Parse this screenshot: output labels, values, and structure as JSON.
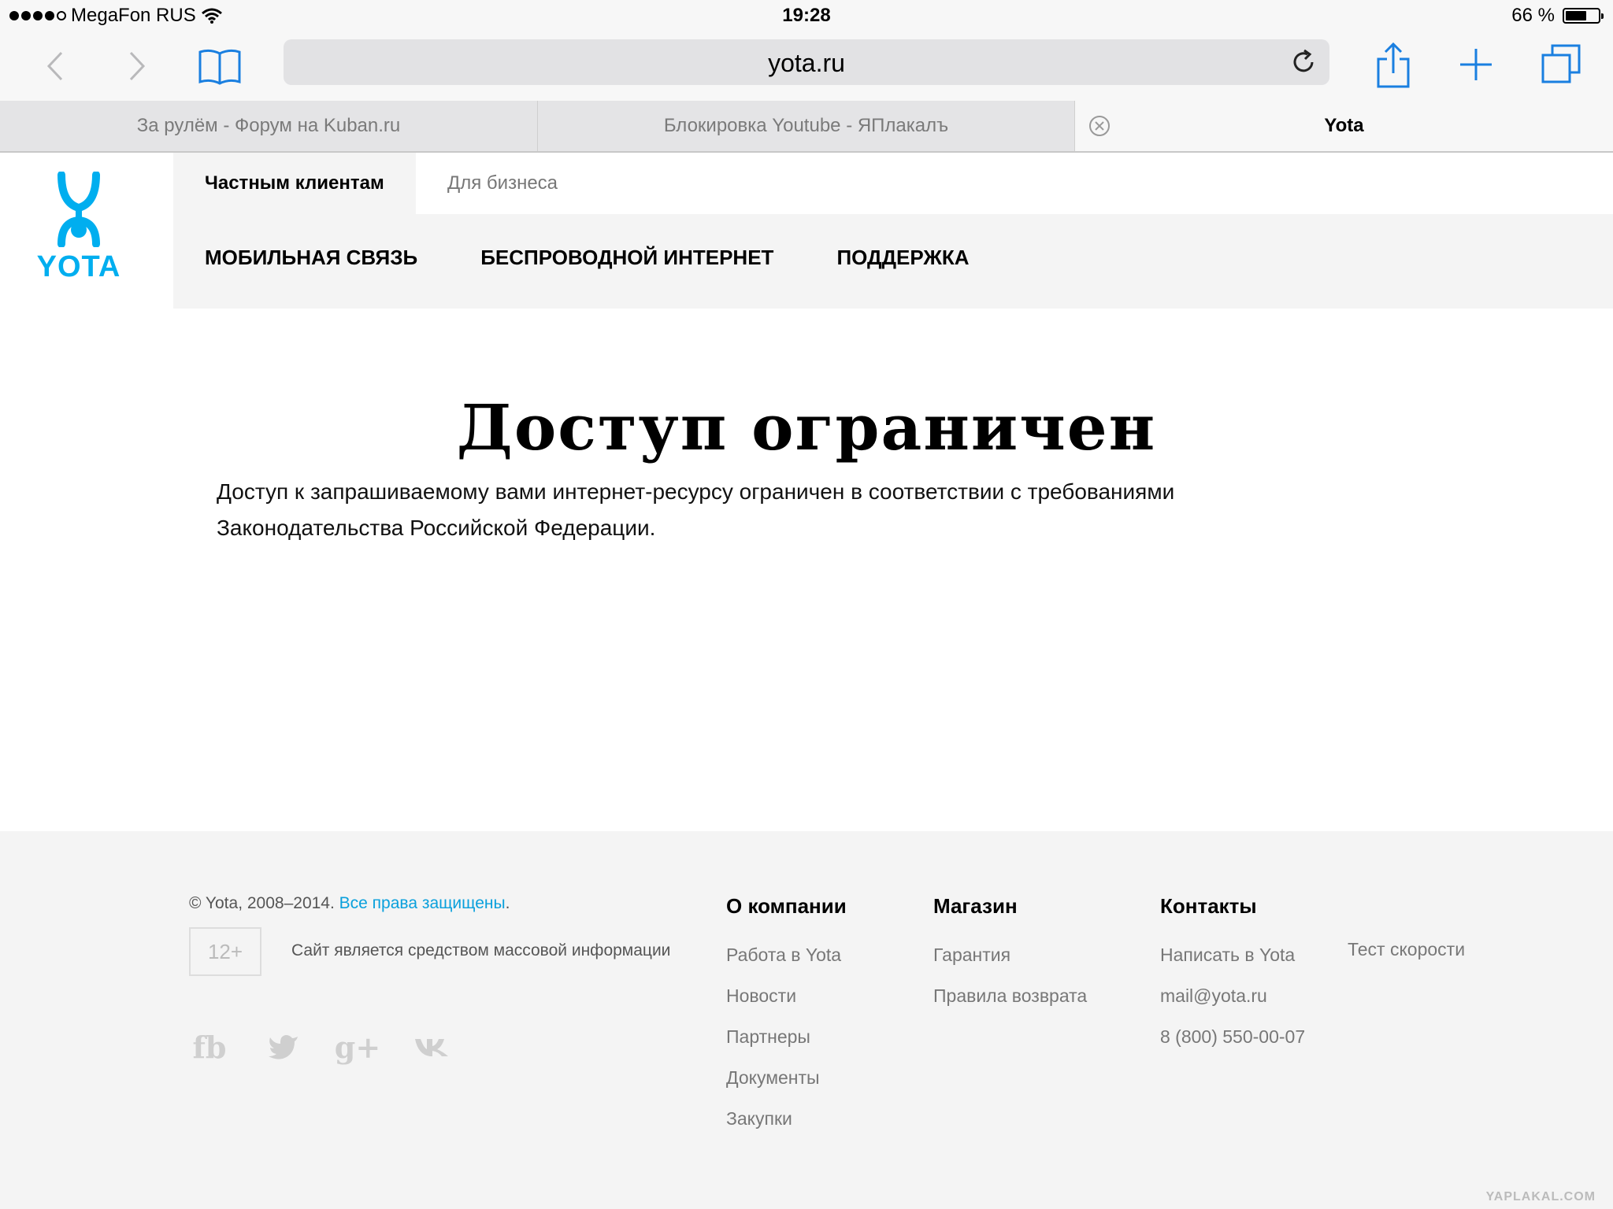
{
  "status_bar": {
    "carrier": "MegaFon RUS",
    "time": "19:28",
    "battery_text": "66 %",
    "battery_level": 0.66
  },
  "toolbar": {
    "url": "yota.ru"
  },
  "tabs": [
    {
      "label": "За рулём - Форум на Kuban.ru"
    },
    {
      "label": "Блокировка Youtube - ЯПлакалъ"
    },
    {
      "label": "Yota"
    }
  ],
  "header": {
    "brand": "YOTA",
    "brand_color": "#00aeef",
    "segments": {
      "private": "Частным клиентам",
      "business": "Для бизнеса"
    },
    "nav": {
      "mobile": "Мобильная связь",
      "wireless": "Беспроводной интернет",
      "support": "Поддержка"
    }
  },
  "content": {
    "title": "Доступ ограничен",
    "text_line1": "Доступ к запрашиваемому вами интернет-ресурсу ограничен в соответствии с требованиями",
    "text_line2": "Законодательства Российской Федерации."
  },
  "footer": {
    "copyright": "© Yota, 2008–2014. ",
    "rights_link": "Все права защищены",
    "rights_period": ".",
    "age_rating": "12+",
    "media_notice": "Сайт является средством массовой информации",
    "socials": {
      "fb": "fb",
      "gplus": "g+"
    },
    "company": {
      "title": "О компании",
      "links": [
        "Работа в Yota",
        "Новости",
        "Партнеры",
        "Документы",
        "Закупки"
      ]
    },
    "shop": {
      "title": "Магазин",
      "links": [
        "Гарантия",
        "Правила возврата"
      ]
    },
    "contacts": {
      "title": "Контакты",
      "links": [
        "Написать в Yota",
        "mail@yota.ru",
        "8 (800) 550-00-07"
      ],
      "extra_links": [
        "Тест скорости"
      ]
    }
  },
  "watermark": "YAPLAKAL.COM"
}
